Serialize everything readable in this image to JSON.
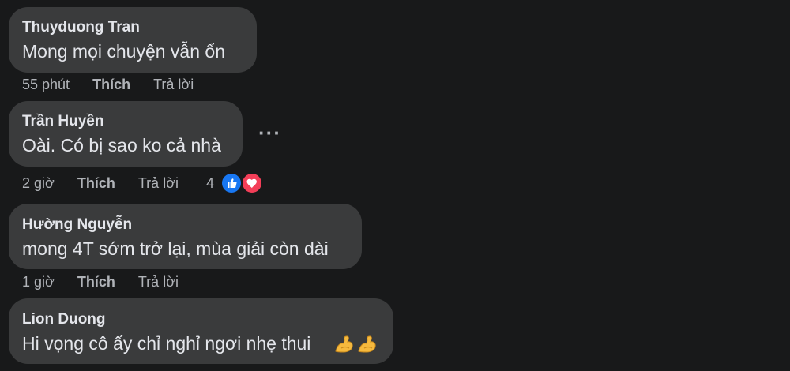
{
  "comments": [
    {
      "author": "Thuyduong Tran",
      "text": "Mong mọi chuyện vẫn ổn",
      "time": "55 phút",
      "like_label": "Thích",
      "reply_label": "Trả lời"
    },
    {
      "author": "Trần Huyền",
      "text": "Oài. Có bị sao ko cả nhà",
      "time": "2 giờ",
      "like_label": "Thích",
      "reply_label": "Trả lời",
      "more_label": "···",
      "reactions": {
        "count": "4",
        "types": [
          "like-icon",
          "love-icon"
        ],
        "like_color": "#1877f2",
        "love_color": "#f33e58"
      }
    },
    {
      "author": "Hường Nguyễn",
      "text": "mong 4T sớm trở lại, mùa giải còn dài",
      "time": "1 giờ",
      "like_label": "Thích",
      "reply_label": "Trả lời"
    },
    {
      "author": "Lion Duong",
      "text": "Hi vọng cô ấy chỉ nghỉ ngơi nhẹ thui",
      "emoji": [
        "flexed-biceps-icon",
        "flexed-biceps-icon"
      ]
    }
  ],
  "colors": {
    "background": "#18191a",
    "bubble": "#3a3b3c",
    "primary_text": "#e4e6eb",
    "secondary_text": "#b0b3b8"
  }
}
